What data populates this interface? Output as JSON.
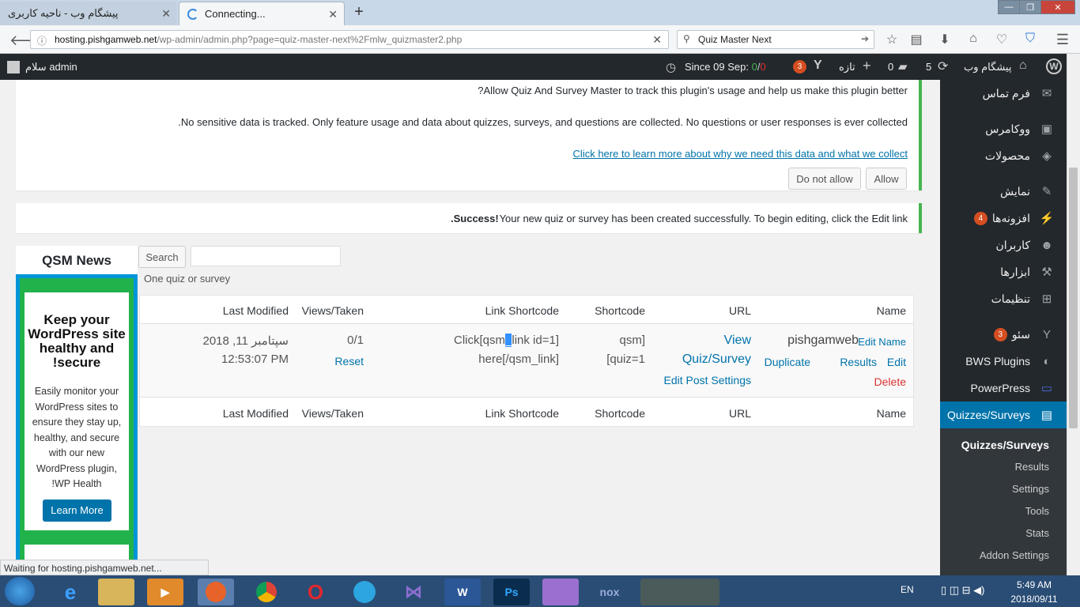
{
  "browser": {
    "tab1_title": "پیشگام وب - ناحیه کاربری",
    "tab2_title": "Connecting...",
    "url_host": "hosting.pishgamweb.net",
    "url_path": "/wp-admin/admin.php?page=quiz-master-next%2Fmlw_quizmaster2.php",
    "search_value": "Quiz Master Next",
    "status_text": "Waiting for hosting.pishgamweb.net..."
  },
  "adminbar": {
    "user": "سلام admin",
    "since": "Since 09 Sep:",
    "since_green": "0",
    "sep": "/",
    "since_red": "0",
    "yoast_count": "3",
    "new_label": "تازه",
    "comments_count": "0",
    "updates_count": "5",
    "site_name": "پیشگام وب"
  },
  "sidebar": {
    "items": [
      {
        "label": "فرم تماس"
      },
      {
        "label": "ووکامرس"
      },
      {
        "label": "محصولات"
      },
      {
        "label": "نمایش"
      },
      {
        "label": "افزونه‌ها",
        "badge": "4"
      },
      {
        "label": "کاربران"
      },
      {
        "label": "ابزارها"
      },
      {
        "label": "تنظیمات"
      },
      {
        "label": "سئو",
        "badge": "3"
      },
      {
        "label": "BWS Plugins"
      },
      {
        "label": "PowerPress"
      },
      {
        "label": "Quizzes/Surveys"
      }
    ],
    "submenu": [
      "Quizzes/Surveys",
      "Results",
      "Settings",
      "Tools",
      "Stats",
      "Addon Settings"
    ]
  },
  "tracking_notice": {
    "line1": "?Allow Quiz And Survey Master to track this plugin's usage and help us make this plugin better",
    "line2": ".No sensitive data is tracked. Only feature usage and data about quizzes, surveys, and questions are collected. No questions or user responses is ever collected",
    "link": "Click here to learn more about why we need this data and what we collect",
    "deny": "Do not allow",
    "allow": "Allow"
  },
  "success_notice": {
    "strong": ".Success!",
    "text": " Your new quiz or survey has been created successfully. To begin editing, click the Edit link"
  },
  "search": {
    "button": "Search",
    "value": "",
    "count": "One quiz or survey"
  },
  "qsm_news": {
    "title": "QSM News",
    "heading": "Keep your WordPress site healthy and !secure",
    "body": "Easily monitor your WordPress sites to ensure they stay up, healthy, and secure with our new WordPress plugin, !WP Health",
    "button": "Learn More"
  },
  "table": {
    "headers": [
      "Name",
      "URL",
      "Shortcode",
      "Link Shortcode",
      "Views/Taken",
      "Last Modified"
    ],
    "row": {
      "name": "pishgamweb",
      "edit_name": "Edit Name",
      "actions": [
        "Edit",
        "Results",
        "Duplicate"
      ],
      "delete": "Delete",
      "view1": "View",
      "view2": "Quiz/Survey",
      "edit_post": "Edit Post Settings",
      "shortcode1": "[qsm",
      "shortcode2": "quiz=1]",
      "link1_a": "Click[qsm",
      "link1_sel": "_",
      "link1_b": "link id=1]",
      "link2": "here[/qsm_link]",
      "views": "0/1",
      "reset": "Reset",
      "modified1": "سپتامبر 11, 2018",
      "modified2": "12:53:07 PM"
    }
  },
  "taskbar": {
    "lang": "EN",
    "time": "5:49 AM",
    "date": "2018/09/11"
  },
  "colors": {
    "wp_dark": "#23282d",
    "link": "#0073aa",
    "success": "#46b450",
    "badge": "#d54e21",
    "qsm_blue": "#0095d9",
    "qsm_green": "#22b24c"
  }
}
